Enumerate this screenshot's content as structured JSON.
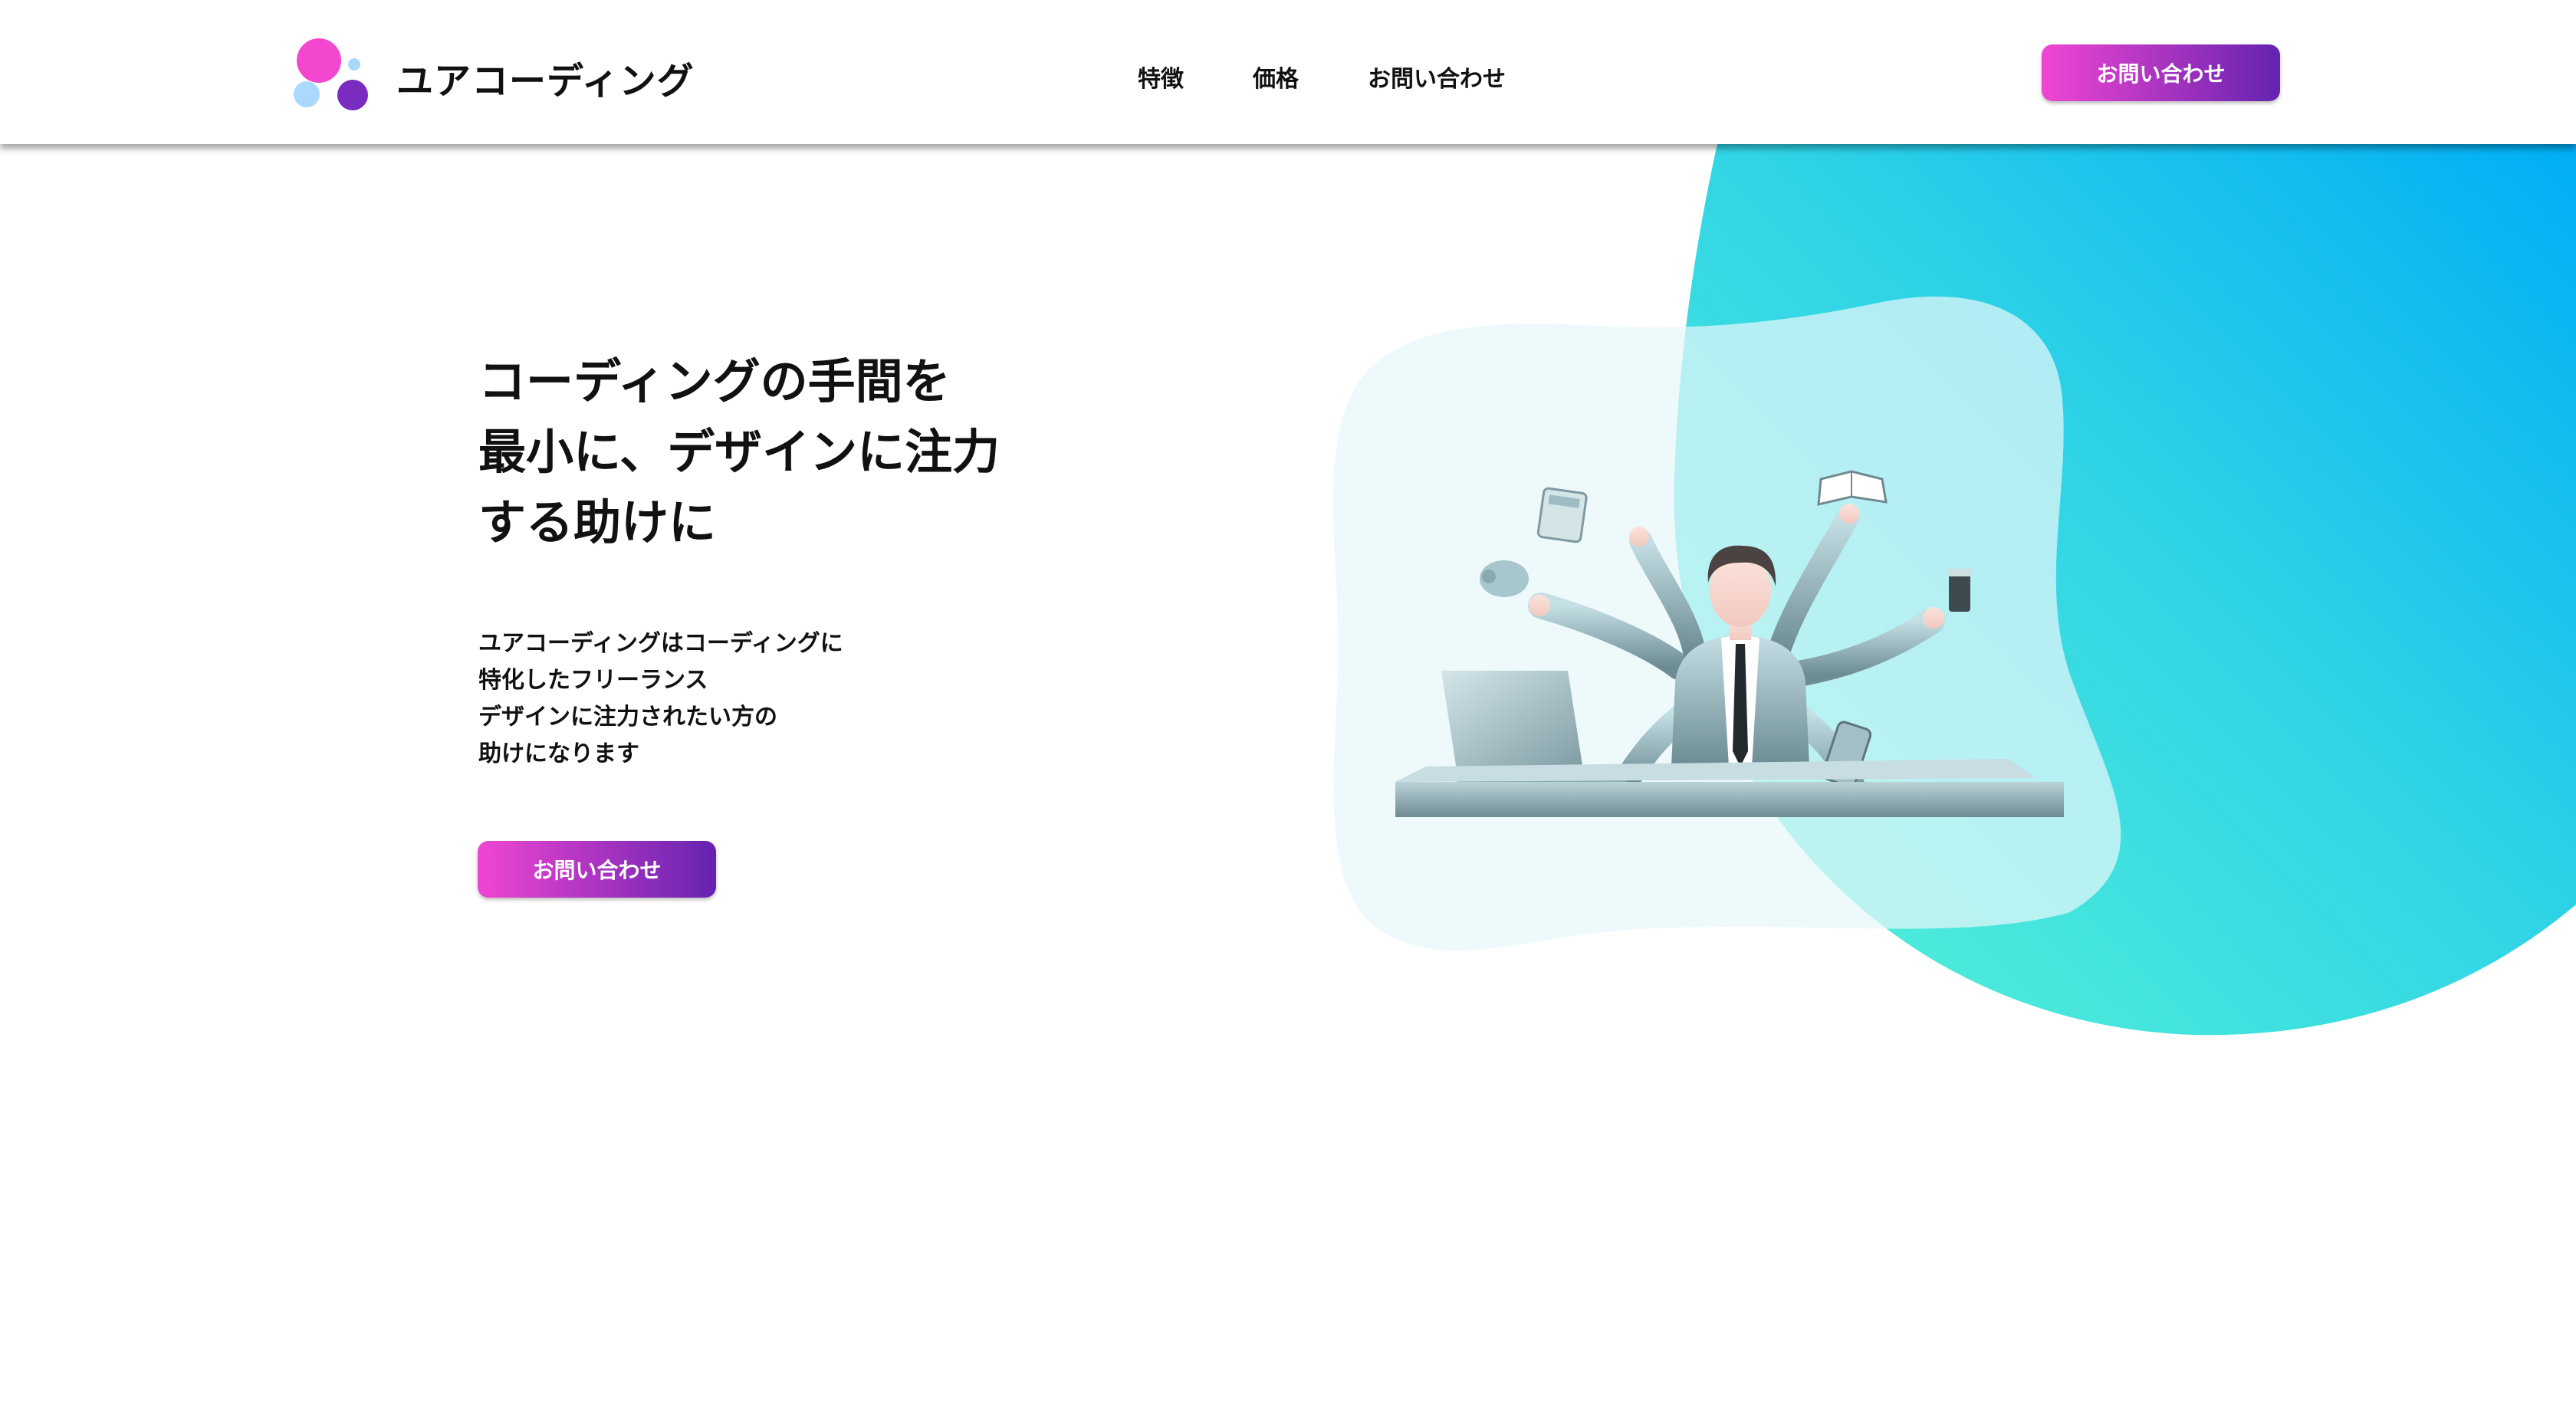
{
  "header": {
    "brand": "ユアコーディング",
    "nav": [
      "特徴",
      "価格",
      "お問い合わせ"
    ],
    "cta_label": "お問い合わせ"
  },
  "hero": {
    "title_lines": [
      "コーディングの手間を",
      "最小に、デザインに注力",
      "する助けに"
    ],
    "description_lines": [
      "ユアコーディングはコーディングに",
      "特化したフリーランス",
      "デザインに注力されたい方の",
      "助けになります"
    ],
    "cta_label": "お問い合わせ"
  },
  "colors": {
    "logo_pink": "#f447cf",
    "logo_light_blue": "#a9d9fb",
    "logo_purple": "#7a2bc0",
    "button_gradient_start": "#f046d2",
    "button_gradient_end": "#6423b0",
    "blob_cyan_start": "#5af5d6",
    "blob_blue_end": "#00aef5"
  },
  "icons": [
    "logo-mark-icon",
    "multitasking-businessman-illustration"
  ]
}
